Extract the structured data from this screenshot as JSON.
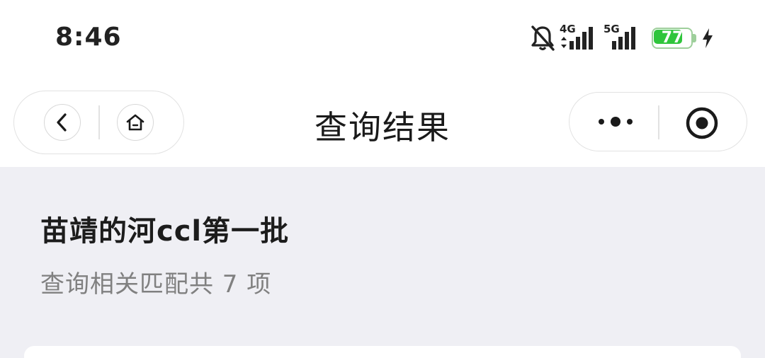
{
  "status_bar": {
    "time": "8:46",
    "network_1": "4G",
    "network_2": "5G",
    "battery": "77",
    "battery_level": 0.77,
    "icons": [
      "bell-muted-icon",
      "signal-4g-icon",
      "signal-5g-icon",
      "battery-icon",
      "charging-bolt-icon"
    ]
  },
  "nav": {
    "title": "查询结果",
    "icons": [
      "back-chevron-icon",
      "home-icon",
      "more-dots-icon",
      "target-icon"
    ]
  },
  "result": {
    "title": "苗靖的河ccl第一批",
    "summary": "查询相关匹配共 7 项"
  },
  "colors": {
    "background": "#efeff4",
    "battery_green": "#2fc53b",
    "summary_text": "#808080"
  }
}
